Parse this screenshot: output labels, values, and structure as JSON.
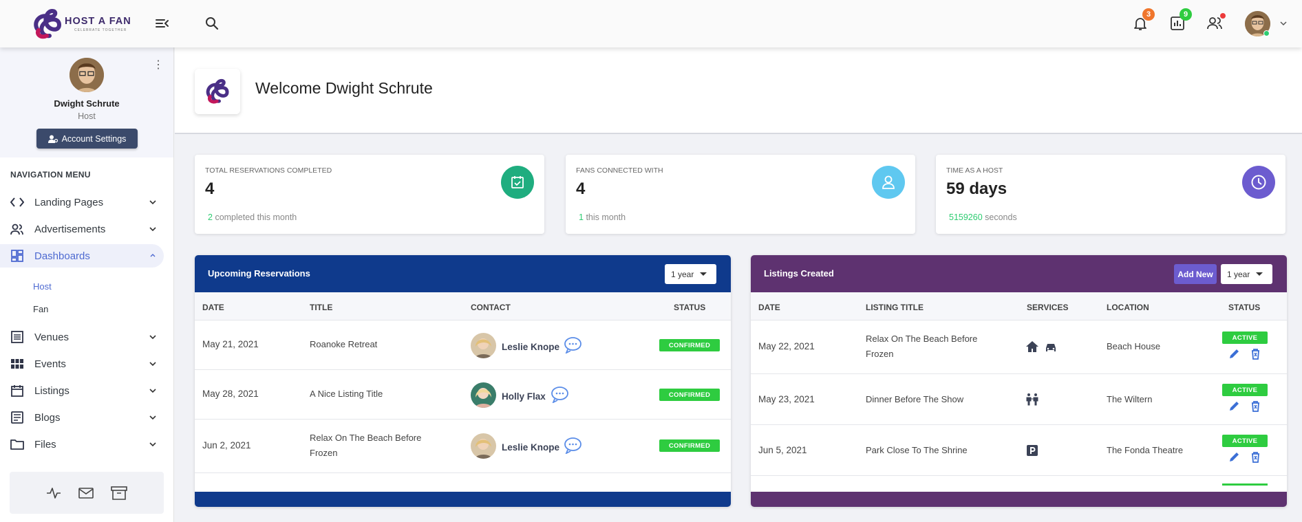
{
  "app": {
    "logo_title": "HOST A FAN",
    "logo_tagline": "CELEBRATE TOGETHER"
  },
  "header": {
    "notifications_count": "3",
    "reports_count": "9",
    "colors": {
      "orange_badge": "#f0762c",
      "green_badge": "#2ecc40",
      "red_dot": "#ec3b3b"
    }
  },
  "sidebar": {
    "user_name": "Dwight  Schrute",
    "user_role": "Host",
    "account_settings_label": "Account Settings",
    "nav_heading": "NAVIGATION MENU",
    "items": [
      {
        "label": "Landing Pages",
        "icon": "code-icon"
      },
      {
        "label": "Advertisements",
        "icon": "users-icon"
      },
      {
        "label": "Dashboards",
        "icon": "dashboard-icon"
      },
      {
        "label": "Venues",
        "icon": "list-icon"
      },
      {
        "label": "Events",
        "icon": "grid-icon"
      },
      {
        "label": "Listings",
        "icon": "calendar-icon"
      },
      {
        "label": "Blogs",
        "icon": "blog-icon"
      },
      {
        "label": "Files",
        "icon": "folder-icon"
      }
    ],
    "dashboard_subitems": [
      {
        "label": "Host"
      },
      {
        "label": "Fan"
      }
    ]
  },
  "welcome": {
    "text": "Welcome Dwight Schrute"
  },
  "stats": [
    {
      "label": "TOTAL RESERVATIONS COMPLETED",
      "value": "4",
      "foot_number": "2",
      "foot_text": "completed this month",
      "icon": "check-calendar-icon",
      "color": "#1fad7f"
    },
    {
      "label": "FANS CONNECTED WITH",
      "value": "4",
      "foot_number": "1",
      "foot_text": "this month",
      "icon": "user-icon",
      "color": "#5fc8f0"
    },
    {
      "label": "TIME AS A HOST",
      "value": "59 days",
      "foot_number": "5159260",
      "foot_text": "seconds",
      "icon": "clock-icon",
      "color": "#6c5ccf"
    }
  ],
  "reservations": {
    "title": "Upcoming Reservations",
    "period": "1 year",
    "color": "#0f3a8c",
    "columns": [
      "DATE",
      "TITLE",
      "CONTACT",
      "STATUS"
    ],
    "rows": [
      {
        "date": "May 21, 2021",
        "title": "Roanoke Retreat",
        "contact": "Leslie Knope",
        "status": "CONFIRMED"
      },
      {
        "date": "May 28, 2021",
        "title": "A Nice Listing Title",
        "contact": "Holly Flax",
        "status": "CONFIRMED"
      },
      {
        "date": "Jun 2, 2021",
        "title_line1": "Relax On The Beach Before",
        "title_line2": "Frozen",
        "contact": "Leslie Knope",
        "status": "CONFIRMED"
      }
    ]
  },
  "listings": {
    "title": "Listings Created",
    "add_label": "Add New",
    "period": "1 year",
    "color": "#5e3270",
    "columns": [
      "DATE",
      "LISTING TITLE",
      "SERVICES",
      "LOCATION",
      "STATUS"
    ],
    "rows": [
      {
        "date": "May 22, 2021",
        "title_line1": "Relax On The Beach Before",
        "title_line2": "Frozen",
        "services": [
          "home-icon",
          "car-icon"
        ],
        "location": "Beach House",
        "status": "ACTIVE"
      },
      {
        "date": "May 23, 2021",
        "title": "Dinner Before The Show",
        "services": [
          "dining-icon"
        ],
        "location": "The Wiltern",
        "status": "ACTIVE"
      },
      {
        "date": "Jun 5, 2021",
        "title": "Park Close To The Shrine",
        "services": [
          "parking-icon"
        ],
        "location": "The Fonda Theatre",
        "status": "ACTIVE"
      }
    ]
  }
}
